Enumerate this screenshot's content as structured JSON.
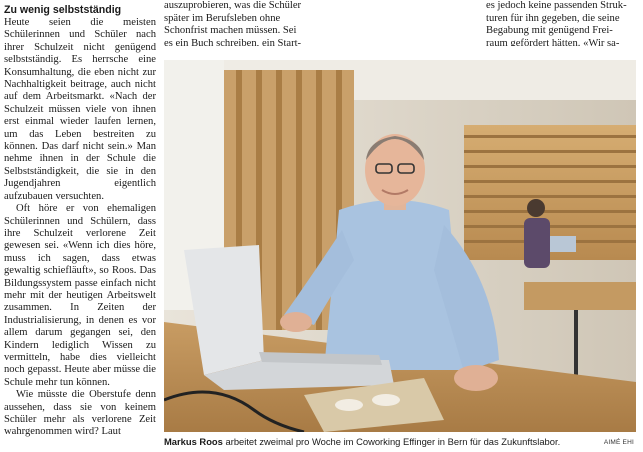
{
  "left_column": {
    "heading": "Zu wenig selbstständig",
    "paragraphs": [
      "Heute seien die meisten Schülerinnen und Schüler nach ihrer Schulzeit nicht genügend selbstständig. Es herrsche eine Konsumhaltung, die eben nicht zur Nachhaltigkeit beitrage, auch nicht auf dem Arbeitsmarkt. «Nach der Schulzeit müssen viele von ihnen erst einmal wieder laufen lernen, um das Leben bestreiten zu können. Das darf nicht sein.» Man nehme ihnen in der Schule die Selbstständigkeit, die sie in den Jugendjahren eigentlich aufzubauen versuchten.",
      "Oft höre er von ehemaligen Schülerinnen und Schülern, dass ihre Schulzeit verlorene Zeit gewesen sei. «Wenn ich dies höre, muss ich sagen, dass etwas gewaltig schiefläuft», so Roos. Das Bildungssystem passe einfach nicht mehr mit der heutigen Arbeitswelt zusammen. In Zeiten der Industrialisierung, in denen es vor allem darum gegangen sei, den Kindern lediglich Wissen zu vermitteln, habe dies vielleicht noch gepasst. Heute aber müsse die Schule mehr tun können.",
      "Wie müsste die Oberstufe denn aussehen, dass sie von keinem Schüler mehr als verlorene Zeit wahrgenommen wird? Laut"
    ]
  },
  "top_middle": {
    "lines": [
      "auszuprobieren, was die Schüler",
      "später im Berufsleben ohne",
      "Schonfrist machen müssen. Sei",
      "es ein Buch schreiben, ein Start-"
    ]
  },
  "top_right": {
    "lines": [
      "es jedoch keine passenden Struk-",
      "turen für ihn gegeben, die seine",
      "Begabung mit genügend Frei-",
      "raum gefördert hätten. «Wir sa-"
    ]
  },
  "caption": {
    "name": "Markus Roos",
    "text": " arbeitet zweimal pro Woche im Coworking Effinger in Bern für das Zukunftslabor.",
    "credit": "AIMÉ EHI"
  },
  "photo": {
    "subject": "man at laptop in coworking space",
    "colors": {
      "wood": "#c49a62",
      "wall": "#d8d3c8",
      "shirt": "#a9c3e0",
      "laptop": "#e4e6e8"
    }
  }
}
